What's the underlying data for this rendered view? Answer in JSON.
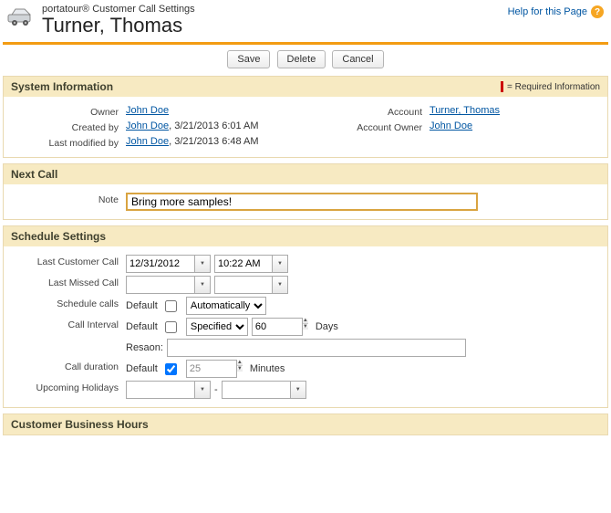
{
  "head": {
    "subtitle": "portatour® Customer Call Settings",
    "title": "Turner, Thomas",
    "help_label": "Help for this Page"
  },
  "buttons": {
    "save": "Save",
    "delete": "Delete",
    "cancel": "Cancel"
  },
  "sections": {
    "sysinfo": {
      "title": "System Information",
      "required_legend": "= Required Information",
      "owner_label": "Owner",
      "owner": "John Doe",
      "createdby_label": "Created by",
      "createdby_name": "John Doe",
      "createdby_time": ", 3/21/2013 6:01 AM",
      "modifiedby_label": "Last modified by",
      "modifiedby_name": "John Doe",
      "modifiedby_time": ", 3/21/2013 6:48 AM",
      "account_label": "Account",
      "account": "Turner, Thomas",
      "accowner_label": "Account Owner",
      "accowner": "John Doe"
    },
    "nextcall": {
      "title": "Next Call",
      "note_label": "Note",
      "note_value": "Bring more samples!"
    },
    "schedule": {
      "title": "Schedule Settings",
      "lastcall_label": "Last Customer Call",
      "lastcall_date": "12/31/2012",
      "lastcall_time": "10:22 AM",
      "lastmissed_label": "Last Missed Call",
      "lastmissed_date": "",
      "lastmissed_time": "",
      "schedcalls_label": "Schedule calls",
      "default_word": "Default",
      "schedcalls_mode": "Automatically",
      "interval_label": "Call Interval",
      "interval_mode": "Specified",
      "interval_value": "60",
      "interval_unit": "Days",
      "reason_label": "Resaon:",
      "reason_value": "",
      "duration_label": "Call duration",
      "duration_value": "25",
      "duration_unit": "Minutes",
      "holidays_label": "Upcoming Holidays",
      "holidays_from": "",
      "holidays_to": "",
      "dash": "-"
    },
    "hours": {
      "title": "Customer Business Hours"
    }
  }
}
